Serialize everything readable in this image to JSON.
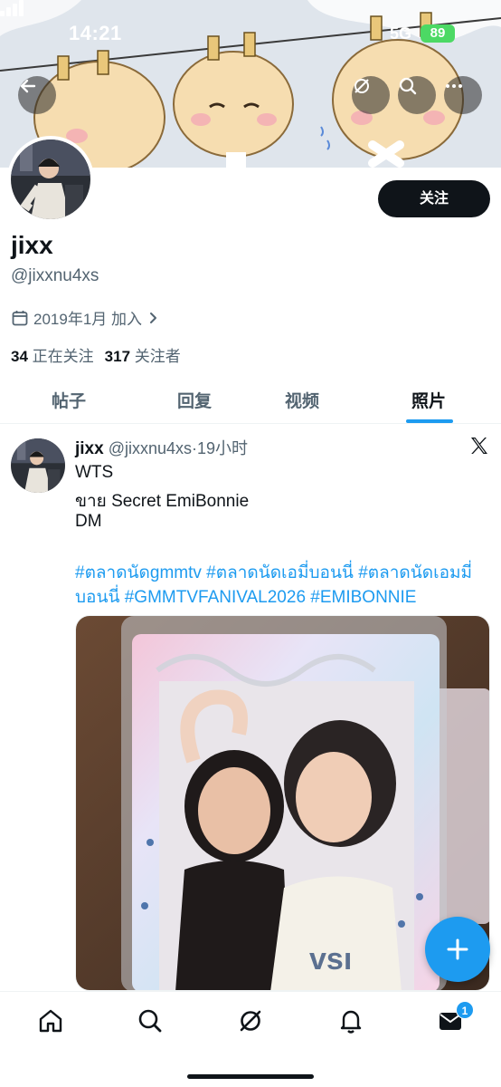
{
  "status_bar": {
    "time": "14:21",
    "network": "5G",
    "battery": "89"
  },
  "banner": {
    "back_icon": "back-arrow-icon",
    "grok_icon": "grok-icon",
    "search_icon": "search-icon",
    "more_icon": "more-icon"
  },
  "profile": {
    "display_name": "jixx",
    "handle": "@jixxnu4xs",
    "joined": "2019年1月 加入",
    "following_count": "34",
    "following_label": "正在关注",
    "followers_count": "317",
    "followers_label": "关注者",
    "follow_button": "关注"
  },
  "tabs": [
    {
      "label": "帖子",
      "active": false
    },
    {
      "label": "回复",
      "active": false
    },
    {
      "label": "视频",
      "active": false
    },
    {
      "label": "照片",
      "active": true
    }
  ],
  "tweet": {
    "name": "jixx",
    "handle": "@jixxnu4xs",
    "separator": "·",
    "time": "19小时",
    "lines": [
      "WTS",
      "ขาย Secret EmiBonnie",
      "DM"
    ],
    "hashtags": "#ตลาดนัดgmmtv #ตลาดนัดเอมี่บอนนี่ #ตลาดนัดเอมมี่บอนนี่ #GMMTVFANIVAL2026 #EMIBONNIE"
  },
  "bottom_nav": {
    "items": [
      "home-icon",
      "search-icon",
      "grok-icon",
      "notifications-icon",
      "messages-icon"
    ],
    "messages_badge": "1"
  },
  "colors": {
    "accent": "#1d9bf0",
    "text": "#0f1419",
    "muted": "#536471",
    "battery": "#4cd964"
  }
}
